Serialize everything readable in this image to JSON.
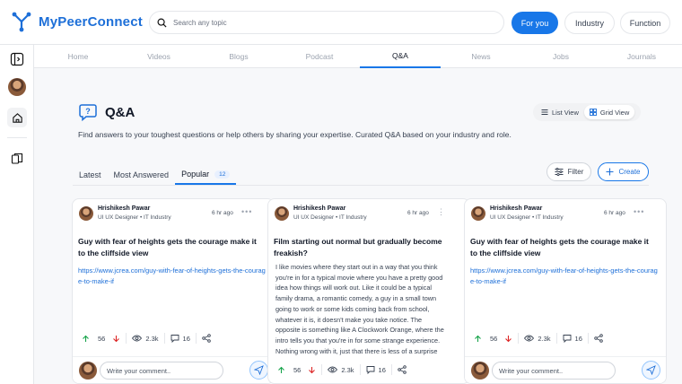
{
  "app": {
    "name": "MyPeerConnect"
  },
  "search": {
    "placeholder": "Search any topic"
  },
  "feeds": [
    {
      "label": "For you"
    },
    {
      "label": "Industry"
    },
    {
      "label": "Function"
    }
  ],
  "nav": [
    "Home",
    "Videos",
    "Blogs",
    "Podcast",
    "Q&A",
    "News",
    "Jobs",
    "Journals"
  ],
  "page": {
    "title": "Q&A",
    "description": "Find answers to your toughest questions or help others by sharing your expertise. Curated Q&A based on your industry and role."
  },
  "views": {
    "list": "List View",
    "grid": "Grid View"
  },
  "tabs": {
    "latest": "Latest",
    "most": "Most Answered",
    "popular": "Popular",
    "popular_count": "12"
  },
  "buttons": {
    "filter": "Filter",
    "create": "Create"
  },
  "cards": [
    {
      "author": "Hrishikesh Pawar",
      "role": "UI UX Designer • IT Industry",
      "time": "6 hr ago",
      "title": "Guy with fear of heights gets the courage make it to the cliffside view",
      "link": "https://www.jcrea.com/guy-with-fear-of-heights-gets-the-courage-to-make-if",
      "upvotes": "56",
      "views": "2.3k",
      "answers": "16",
      "comment_placeholder": "Write your comment.."
    },
    {
      "author": "Hrishikesh Pawar",
      "role": "UI UX Designer • IT Industry",
      "time": "6 hr ago",
      "title": "Film starting out normal but gradually become freakish?",
      "body": "I like movies where they start out in a way that you think you're in for a typical movie where you have a pretty good idea how things will work out. Like it could be a typical family drama, a romantic comedy, a guy in a small town going to work or some kids coming back from school, whatever it is, it doesn't make you take notice. The opposite is something like A Clockwork Orange, where the intro tells you that you're in for some strange experience. Nothing wrong with it, just that there is less of a surprise than with the movies I'm talki...",
      "upvotes": "56",
      "views": "2.3k",
      "answers": "16",
      "comment_placeholder": "Write your comment.."
    },
    {
      "author": "Hrishikesh Pawar",
      "role": "UI UX Designer • IT Industry",
      "time": "6 hr ago",
      "title": "Guy with fear of heights gets the courage make it to the cliffside view",
      "link": "https://www.jcrea.com/guy-with-fear-of-heights-gets-the-courage-to-make-if",
      "upvotes": "56",
      "views": "2.3k",
      "answers": "16",
      "comment_placeholder": "Write your comment.."
    }
  ],
  "colors": {
    "accent": "#1877e8",
    "up": "#16a34a",
    "down": "#dc2626"
  }
}
